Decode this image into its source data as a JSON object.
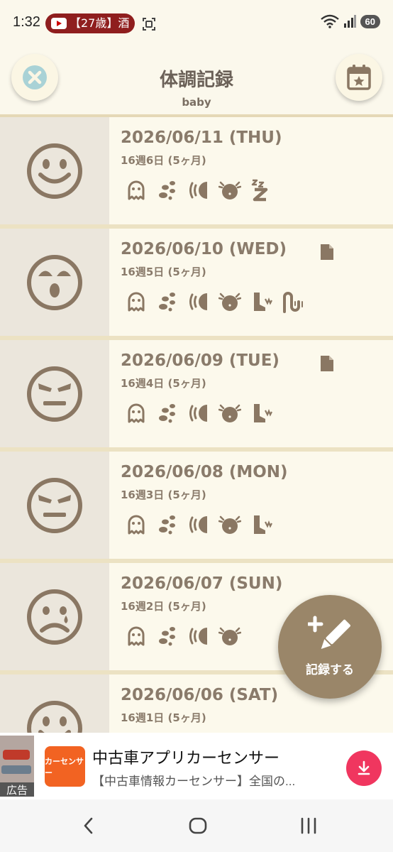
{
  "status_bar": {
    "time": "1:32",
    "notification": "【27歳】酒",
    "battery": "60"
  },
  "header": {
    "title": "体調記録",
    "subtitle": "baby"
  },
  "records": [
    {
      "date": "2026/06/11 (THU)",
      "age": "16週6日 (5ヶ月)",
      "mood": "smile",
      "has_note": false,
      "icons": [
        "ghost-icon",
        "poop-icon",
        "sound-icon",
        "tummy-icon",
        "sleep-icon"
      ]
    },
    {
      "date": "2026/06/10 (WED)",
      "age": "16週5日 (5ヶ月)",
      "mood": "crying",
      "has_note": true,
      "icons": [
        "ghost-icon",
        "poop-icon",
        "sound-icon",
        "tummy-icon",
        "foot-icon",
        "twist-icon"
      ]
    },
    {
      "date": "2026/06/09 (TUE)",
      "age": "16週4日 (5ヶ月)",
      "mood": "angry",
      "has_note": true,
      "icons": [
        "ghost-icon",
        "poop-icon",
        "sound-icon",
        "tummy-icon",
        "foot-icon"
      ]
    },
    {
      "date": "2026/06/08 (MON)",
      "age": "16週3日 (5ヶ月)",
      "mood": "angry",
      "has_note": false,
      "icons": [
        "ghost-icon",
        "poop-icon",
        "sound-icon",
        "tummy-icon",
        "foot-icon"
      ]
    },
    {
      "date": "2026/06/07 (SUN)",
      "age": "16週2日 (5ヶ月)",
      "mood": "sad",
      "has_note": false,
      "icons": [
        "ghost-icon",
        "poop-icon",
        "sound-icon",
        "tummy-icon"
      ]
    },
    {
      "date": "2026/06/06 (SAT)",
      "age": "16週1日 (5ヶ月)",
      "mood": "smile",
      "has_note": false,
      "icons": []
    }
  ],
  "fab": {
    "label": "記録する"
  },
  "ad": {
    "badge": "広告",
    "logo_text": "カーセンサー",
    "title": "中古車アプリカーセンサー",
    "description": "【中古車情報カーセンサー】全国の..."
  },
  "colors": {
    "accent": "#9a8669",
    "icon": "#8a7763",
    "background": "#fbf8ec",
    "mood_bg": "#ebe6dc",
    "ad_download": "#f0365f"
  }
}
